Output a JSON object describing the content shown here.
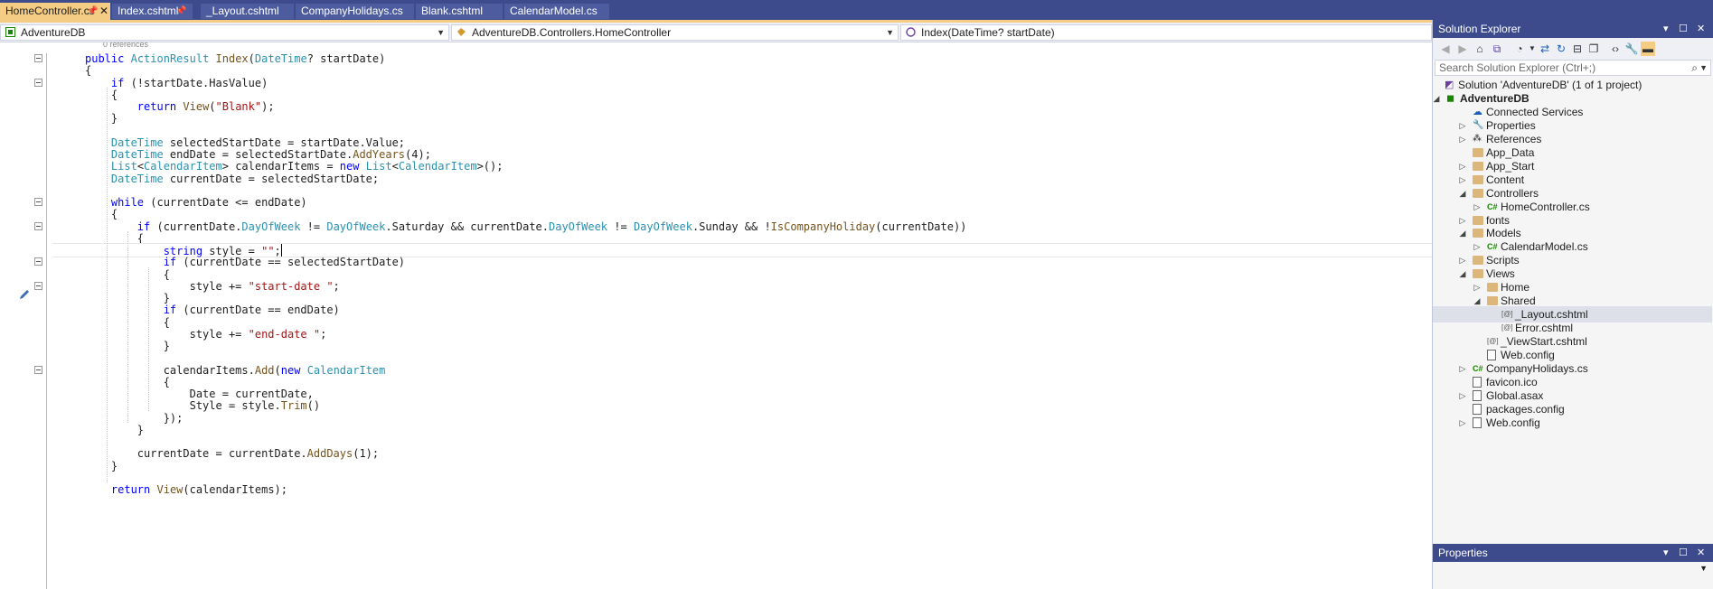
{
  "tabs": [
    {
      "label": "HomeController.cs",
      "active": true,
      "pinned": true
    },
    {
      "label": "Index.cshtml",
      "active": false,
      "pinned": true
    },
    {
      "label": "_Layout.cshtml",
      "active": false,
      "pinned": false
    },
    {
      "label": "CompanyHolidays.cs",
      "active": false,
      "pinned": false
    },
    {
      "label": "Blank.cshtml",
      "active": false,
      "pinned": false
    },
    {
      "label": "CalendarModel.cs",
      "active": false,
      "pinned": false
    }
  ],
  "navbar": {
    "project": "AdventureDB",
    "class_scope": "AdventureDB.Controllers.HomeController",
    "member": "Index(DateTime? startDate)"
  },
  "code": {
    "references": "0 references",
    "lines": [
      "public ActionResult Index(DateTime? startDate)",
      "{",
      "    if (!startDate.HasValue)",
      "    {",
      "        return View(\"Blank\");",
      "    }",
      "",
      "    DateTime selectedStartDate = startDate.Value;",
      "    DateTime endDate = selectedStartDate.AddYears(4);",
      "    List<CalendarItem> calendarItems = new List<CalendarItem>();",
      "    DateTime currentDate = selectedStartDate;",
      "",
      "    while (currentDate <= endDate)",
      "    {",
      "        if (currentDate.DayOfWeek != DayOfWeek.Saturday && currentDate.DayOfWeek != DayOfWeek.Sunday && !IsCompanyHoliday(currentDate))",
      "        {",
      "            string style = \"\";",
      "            if (currentDate == selectedStartDate)",
      "            {",
      "                style += \"start-date \";",
      "            }",
      "            if (currentDate == endDate)",
      "            {",
      "                style += \"end-date \";",
      "            }",
      "",
      "            calendarItems.Add(new CalendarItem",
      "            {",
      "                Date = currentDate,",
      "                Style = style.Trim()",
      "            });",
      "        }",
      "",
      "        currentDate = currentDate.AddDays(1);",
      "    }",
      "",
      "    return View(calendarItems);"
    ]
  },
  "solution_explorer": {
    "title": "Solution Explorer",
    "search_placeholder": "Search Solution Explorer (Ctrl+;)",
    "tree": [
      {
        "label": "Solution 'AdventureDB' (1 of 1 project)",
        "icon": "solution-icon"
      },
      {
        "label": "AdventureDB",
        "icon": "project-icon",
        "bold": true,
        "expander": "expanded"
      },
      {
        "label": "Connected Services",
        "icon": "connected-services-icon"
      },
      {
        "label": "Properties",
        "icon": "wrench-icon",
        "expander": "collapsed"
      },
      {
        "label": "References",
        "icon": "references-icon",
        "expander": "collapsed"
      },
      {
        "label": "App_Data",
        "icon": "folder-icon"
      },
      {
        "label": "App_Start",
        "icon": "folder-icon",
        "expander": "collapsed"
      },
      {
        "label": "Content",
        "icon": "folder-icon",
        "expander": "collapsed"
      },
      {
        "label": "Controllers",
        "icon": "folder-open-icon",
        "expander": "expanded"
      },
      {
        "label": "HomeController.cs",
        "icon": "csharp-file-icon",
        "expander": "collapsed"
      },
      {
        "label": "fonts",
        "icon": "folder-icon",
        "expander": "collapsed"
      },
      {
        "label": "Models",
        "icon": "folder-open-icon",
        "expander": "expanded"
      },
      {
        "label": "CalendarModel.cs",
        "icon": "csharp-file-icon",
        "expander": "collapsed"
      },
      {
        "label": "Scripts",
        "icon": "folder-icon",
        "expander": "collapsed"
      },
      {
        "label": "Views",
        "icon": "folder-open-icon",
        "expander": "expanded"
      },
      {
        "label": "Home",
        "icon": "folder-icon",
        "expander": "collapsed"
      },
      {
        "label": "Shared",
        "icon": "folder-open-icon",
        "expander": "expanded"
      },
      {
        "label": "_Layout.cshtml",
        "icon": "razor-file-icon",
        "selected": true
      },
      {
        "label": "Error.cshtml",
        "icon": "razor-file-icon"
      },
      {
        "label": "_ViewStart.cshtml",
        "icon": "razor-file-icon"
      },
      {
        "label": "Web.config",
        "icon": "config-file-icon"
      },
      {
        "label": "CompanyHolidays.cs",
        "icon": "csharp-file-icon",
        "expander": "collapsed"
      },
      {
        "label": "favicon.ico",
        "icon": "image-file-icon"
      },
      {
        "label": "Global.asax",
        "icon": "asax-file-icon",
        "expander": "collapsed"
      },
      {
        "label": "packages.config",
        "icon": "config-file-icon"
      },
      {
        "label": "Web.config",
        "icon": "config-file-icon",
        "expander": "collapsed"
      }
    ]
  },
  "properties_panel": {
    "title": "Properties"
  },
  "colors": {
    "titlebar": "#3d4b8c",
    "active_tab": "#f5cc84",
    "keyword": "#0000ff",
    "type": "#2b91af",
    "string": "#a31515",
    "method": "#74531f"
  }
}
